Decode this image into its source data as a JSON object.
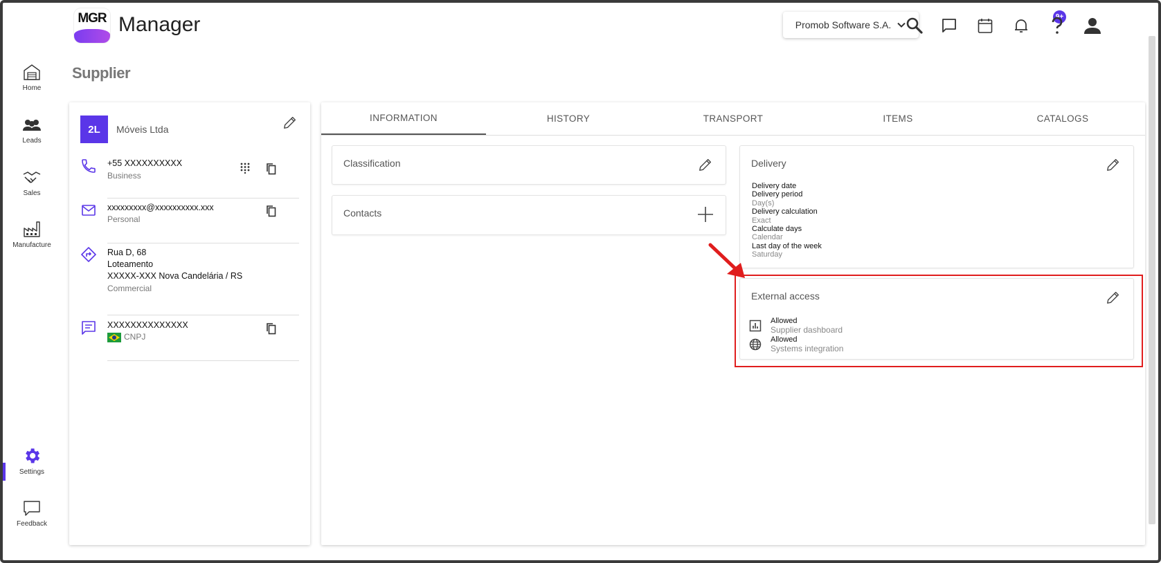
{
  "app": {
    "logo_text": "MGR",
    "title": "Manager"
  },
  "header": {
    "company": "Promob Software S.A.",
    "notifications_badge": "9+"
  },
  "nav": {
    "items": [
      {
        "label": "Home",
        "icon": "home-icon"
      },
      {
        "label": "Leads",
        "icon": "people-icon"
      },
      {
        "label": "Sales",
        "icon": "handshake-icon"
      },
      {
        "label": "Manufacture",
        "icon": "factory-icon"
      },
      {
        "label": "Settings",
        "icon": "gear-icon"
      },
      {
        "label": "Feedback",
        "icon": "feedback-icon"
      }
    ],
    "active": "Settings"
  },
  "page": {
    "title": "Supplier"
  },
  "supplier": {
    "initials": "2L",
    "name": "Móveis Ltda",
    "phone": {
      "value": "+55 XXXXXXXXXX",
      "type": "Business"
    },
    "email": {
      "value": "xxxxxxxxx@xxxxxxxxxx.xxx",
      "type": "Personal"
    },
    "address": {
      "line1": "Rua D, 68",
      "line2": "Loteamento",
      "line3": "XXXXX-XXX Nova Candelária / RS",
      "type": "Commercial"
    },
    "document": {
      "value": "XXXXXXXXXXXXXX",
      "type": "CNPJ"
    }
  },
  "tabs": [
    "INFORMATION",
    "HISTORY",
    "TRANSPORT",
    "ITEMS",
    "CATALOGS"
  ],
  "active_tab": "INFORMATION",
  "cards": {
    "classification": {
      "title": "Classification"
    },
    "contacts": {
      "title": "Contacts"
    },
    "delivery": {
      "title": "Delivery",
      "fields": [
        {
          "label": "Delivery date",
          "value": ""
        },
        {
          "label": "Delivery period",
          "value": "Day(s)"
        },
        {
          "label": "Delivery calculation",
          "value": "Exact"
        },
        {
          "label": "Calculate days",
          "value": "Calendar"
        },
        {
          "label": "Last day of the week",
          "value": "Saturday"
        }
      ]
    },
    "external_access": {
      "title": "External access",
      "items": [
        {
          "status": "Allowed",
          "label": "Supplier dashboard",
          "icon": "chart-icon"
        },
        {
          "status": "Allowed",
          "label": "Systems integration",
          "icon": "globe-icon"
        }
      ]
    }
  },
  "colors": {
    "accent": "#5a36e8",
    "highlight": "#e01d1d"
  }
}
